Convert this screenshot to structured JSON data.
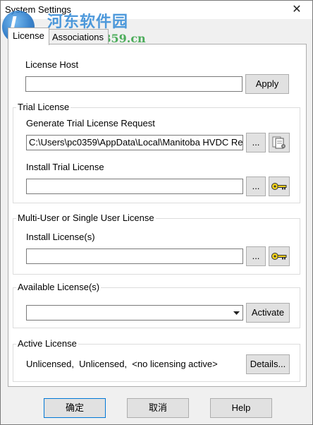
{
  "window": {
    "title": "System Settings",
    "close_glyph": "✕"
  },
  "watermark": {
    "site_name": "河东软件园",
    "url": "www.pc0359.cn",
    "brand_blue": "#3b8fd8",
    "brand_green": "#3aa54a"
  },
  "tabs": [
    {
      "label": "License",
      "active": true
    },
    {
      "label": "Associations",
      "active": false
    }
  ],
  "license_host": {
    "label": "License Host",
    "value": "",
    "apply_label": "Apply"
  },
  "trial_license": {
    "group_title": "Trial License",
    "generate_label": "Generate Trial License Request",
    "generate_value": "C:\\Users\\pc0359\\AppData\\Local\\Manitoba HVDC Re",
    "browse_label": "...",
    "generate_icon": "document-gear-icon",
    "install_label": "Install Trial License",
    "install_value": "",
    "install_browse_label": "...",
    "install_icon": "key-icon"
  },
  "multi_user": {
    "group_title": "Multi-User or Single User License",
    "install_label": "Install License(s)",
    "install_value": "",
    "browse_label": "...",
    "install_icon": "key-icon"
  },
  "available": {
    "group_title": "Available License(s)",
    "selected": "",
    "activate_label": "Activate"
  },
  "active": {
    "group_title": "Active License",
    "status": "Unlicensed,  Unlicensed,  <no licensing active>",
    "details_label": "Details..."
  },
  "footer": {
    "ok_label": "确定",
    "cancel_label": "取消",
    "help_label": "Help"
  },
  "colors": {
    "key_yellow": "#f2d21b",
    "focus_blue": "#0078d7"
  }
}
